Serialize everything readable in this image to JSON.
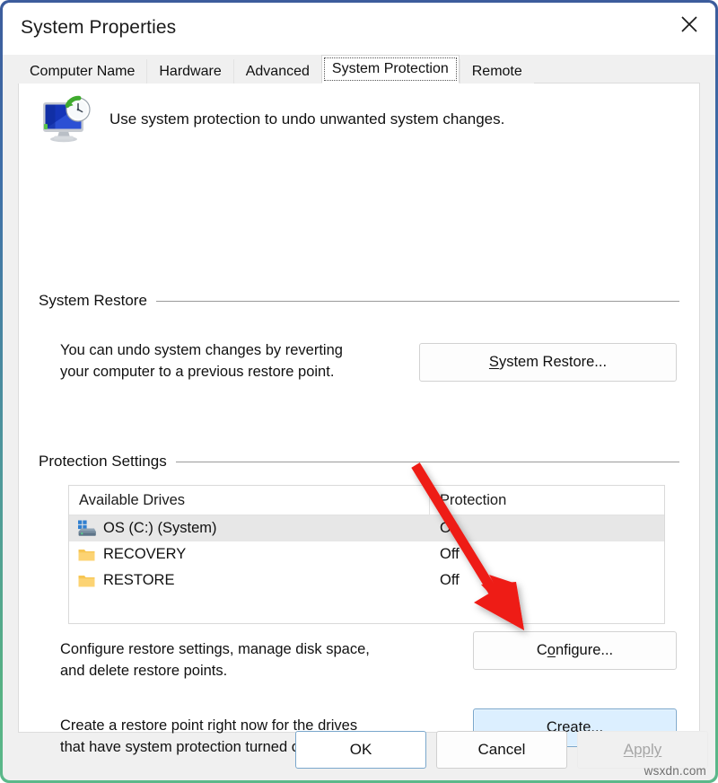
{
  "window": {
    "title": "System Properties",
    "close_icon": "close-icon"
  },
  "tabs": [
    {
      "label": "Computer Name",
      "active": false
    },
    {
      "label": "Hardware",
      "active": false
    },
    {
      "label": "Advanced",
      "active": false
    },
    {
      "label": "System Protection",
      "active": true
    },
    {
      "label": "Remote",
      "active": false
    }
  ],
  "intro": {
    "icon": "system-protection-icon",
    "text": "Use system protection to undo unwanted system changes."
  },
  "system_restore": {
    "group_label": "System Restore",
    "description_line1": "You can undo system changes by reverting",
    "description_line2": "your computer to a previous restore point.",
    "button": {
      "label": "System Restore...",
      "accesskey": "S",
      "state": "normal"
    }
  },
  "protection_settings": {
    "group_label": "Protection Settings",
    "columns": [
      "Available Drives",
      "Protection"
    ],
    "rows": [
      {
        "icon": "windows-drive-icon",
        "drive": "OS (C:) (System)",
        "protection": "On",
        "selected": true
      },
      {
        "icon": "folder-icon",
        "drive": "RECOVERY",
        "protection": "Off",
        "selected": false
      },
      {
        "icon": "folder-icon",
        "drive": "RESTORE",
        "protection": "Off",
        "selected": false
      }
    ],
    "configure": {
      "description_line1": "Configure restore settings, manage disk space,",
      "description_line2": "and delete restore points.",
      "button": {
        "label": "Configure...",
        "accesskey": "o",
        "state": "normal"
      }
    },
    "create": {
      "description_line1": "Create a restore point right now for the drives",
      "description_line2": "that have system protection turned on.",
      "button": {
        "label": "Create...",
        "accesskey": "C",
        "state": "focused"
      }
    }
  },
  "footer": {
    "ok": "OK",
    "cancel": "Cancel",
    "apply": "Apply",
    "apply_disabled": true
  },
  "watermark": "wsxdn.com",
  "annotation": {
    "type": "red-arrow",
    "points_to": "Create...",
    "color": "#ee1c16"
  },
  "colors": {
    "frame_top": "#3c5c9c",
    "frame_bottom": "#5bb88a",
    "dialog_bg": "#f0f0f0",
    "page_bg": "#ffffff",
    "focus_button_fill": "#dcefff",
    "focus_button_border": "#7aa7cc",
    "selection_row": "#e7e7e7"
  }
}
